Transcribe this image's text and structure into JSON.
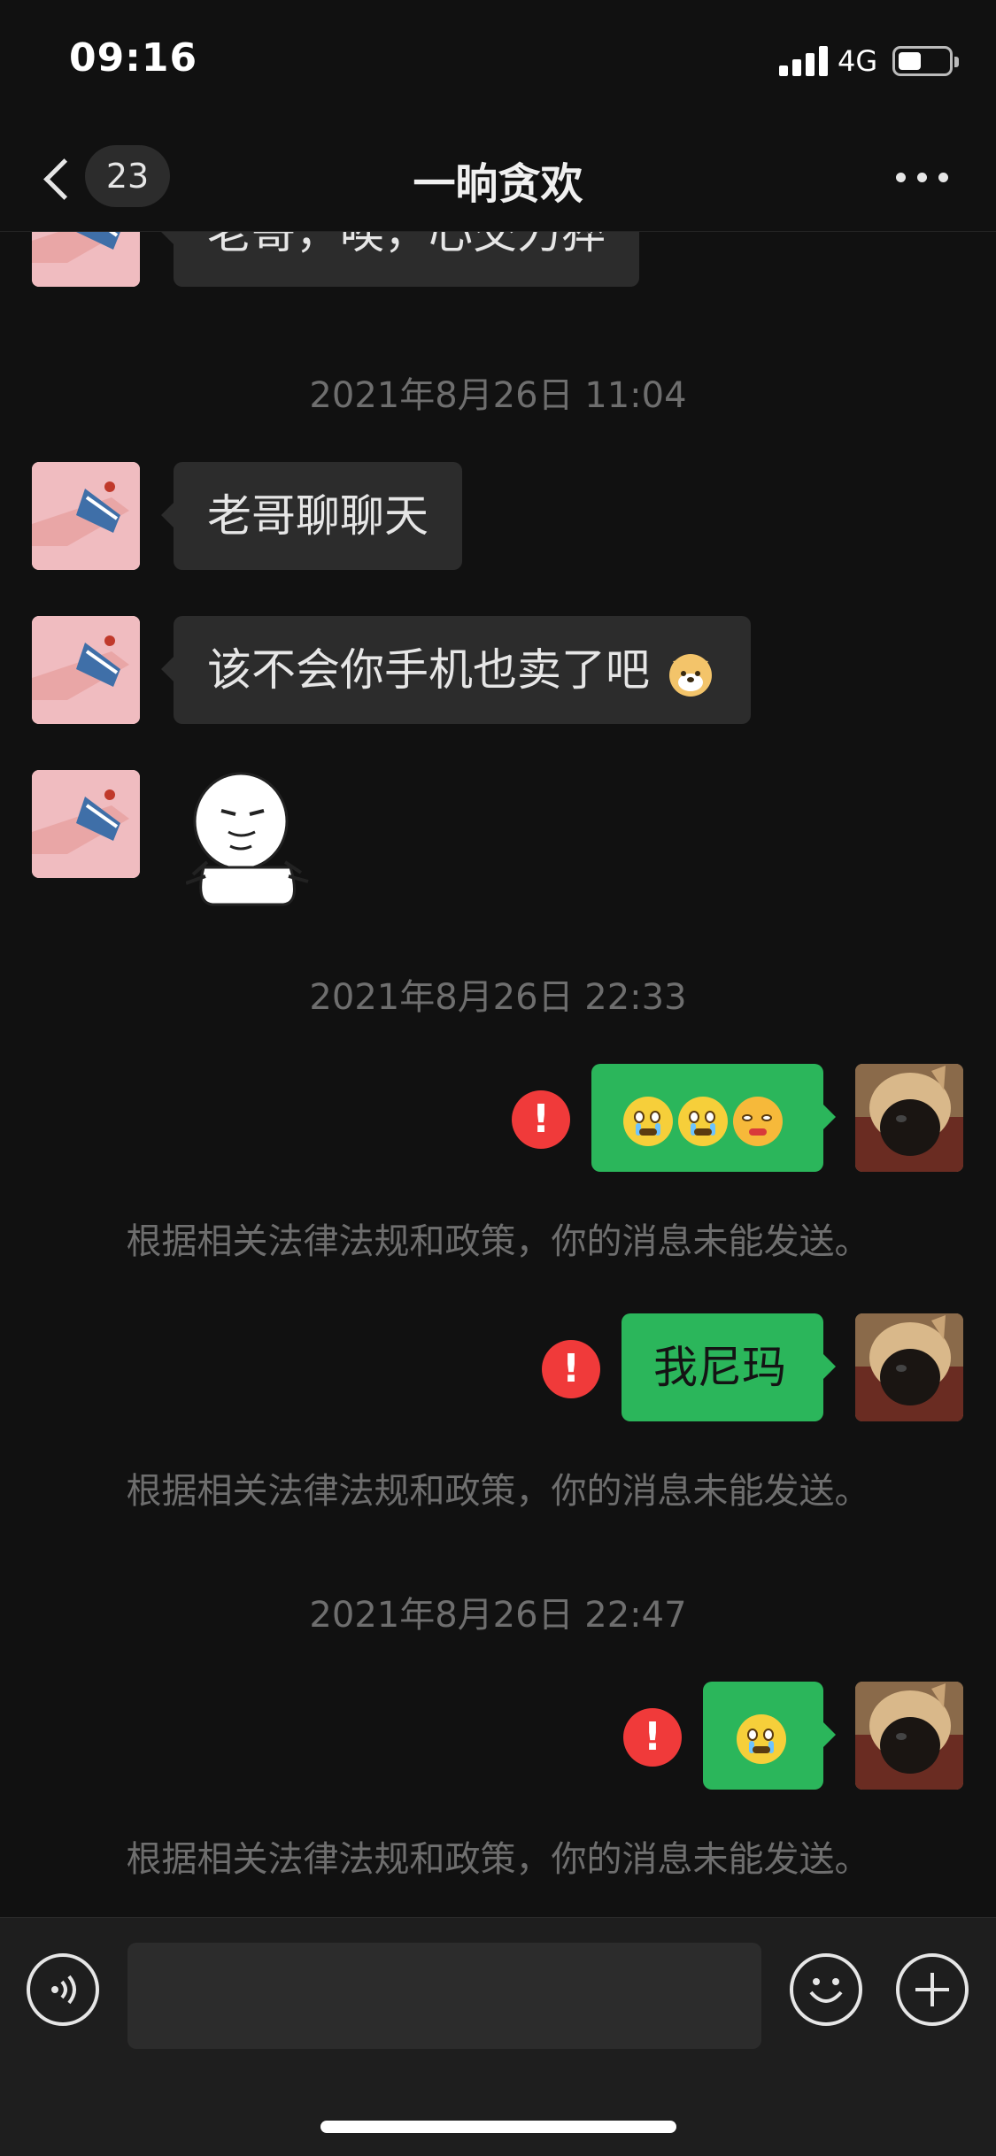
{
  "status_bar": {
    "time": "09:16",
    "network": "4G",
    "battery_level": 0.45
  },
  "nav": {
    "unread_count": "23",
    "title": "一晌贪欢"
  },
  "messages": {
    "partial_top": "老哥，唉，心交力猝",
    "ts1": "2021年8月26日 11:04",
    "m1": "老哥聊聊天",
    "m2": "该不会你手机也卖了吧",
    "ts2": "2021年8月26日 22:33",
    "m4": "我尼玛",
    "ts3": "2021年8月26日 22:47",
    "error_mark": "!",
    "notice": "根据相关法律法规和政策，你的消息未能发送。"
  },
  "icons": {
    "back": "chevron-left-icon",
    "more": "more-dots-icon",
    "voice": "voice-icon",
    "emoji": "emoji-icon",
    "plus": "plus-icon"
  },
  "colors": {
    "background": "#111111",
    "incoming_bubble": "#2c2c2c",
    "outgoing_bubble": "#2bb65b",
    "error": "#f03a3a",
    "meta_text": "#6e6e6e"
  }
}
